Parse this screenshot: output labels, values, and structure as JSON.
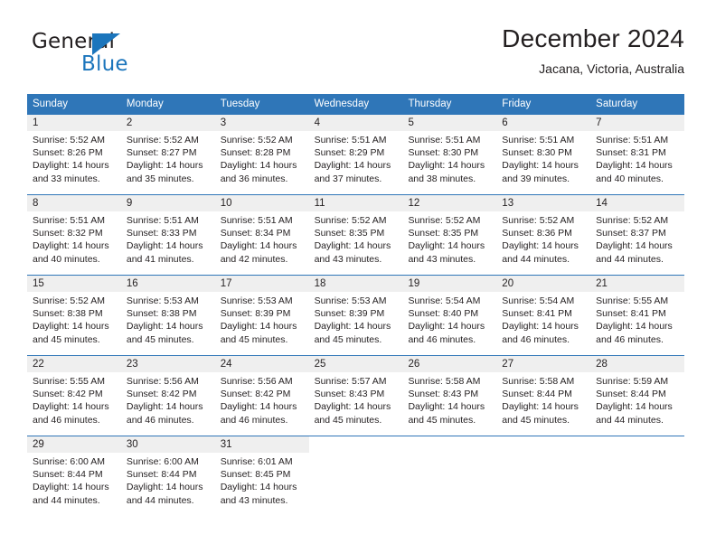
{
  "brand": {
    "name_top": "General",
    "name_bottom": "Blue",
    "accent_color": "#1b75bc",
    "triangle_icon": "logo-triangle"
  },
  "header": {
    "title": "December 2024",
    "subtitle": "Jacana, Victoria, Australia"
  },
  "calendar": {
    "header_bg": "#2f76b8",
    "header_text_color": "#ffffff",
    "daynum_bg": "#efefef",
    "weekdays": [
      "Sunday",
      "Monday",
      "Tuesday",
      "Wednesday",
      "Thursday",
      "Friday",
      "Saturday"
    ],
    "weeks": [
      [
        {
          "day": "1",
          "sunrise": "Sunrise: 5:52 AM",
          "sunset": "Sunset: 8:26 PM",
          "daylight": "Daylight: 14 hours and 33 minutes."
        },
        {
          "day": "2",
          "sunrise": "Sunrise: 5:52 AM",
          "sunset": "Sunset: 8:27 PM",
          "daylight": "Daylight: 14 hours and 35 minutes."
        },
        {
          "day": "3",
          "sunrise": "Sunrise: 5:52 AM",
          "sunset": "Sunset: 8:28 PM",
          "daylight": "Daylight: 14 hours and 36 minutes."
        },
        {
          "day": "4",
          "sunrise": "Sunrise: 5:51 AM",
          "sunset": "Sunset: 8:29 PM",
          "daylight": "Daylight: 14 hours and 37 minutes."
        },
        {
          "day": "5",
          "sunrise": "Sunrise: 5:51 AM",
          "sunset": "Sunset: 8:30 PM",
          "daylight": "Daylight: 14 hours and 38 minutes."
        },
        {
          "day": "6",
          "sunrise": "Sunrise: 5:51 AM",
          "sunset": "Sunset: 8:30 PM",
          "daylight": "Daylight: 14 hours and 39 minutes."
        },
        {
          "day": "7",
          "sunrise": "Sunrise: 5:51 AM",
          "sunset": "Sunset: 8:31 PM",
          "daylight": "Daylight: 14 hours and 40 minutes."
        }
      ],
      [
        {
          "day": "8",
          "sunrise": "Sunrise: 5:51 AM",
          "sunset": "Sunset: 8:32 PM",
          "daylight": "Daylight: 14 hours and 40 minutes."
        },
        {
          "day": "9",
          "sunrise": "Sunrise: 5:51 AM",
          "sunset": "Sunset: 8:33 PM",
          "daylight": "Daylight: 14 hours and 41 minutes."
        },
        {
          "day": "10",
          "sunrise": "Sunrise: 5:51 AM",
          "sunset": "Sunset: 8:34 PM",
          "daylight": "Daylight: 14 hours and 42 minutes."
        },
        {
          "day": "11",
          "sunrise": "Sunrise: 5:52 AM",
          "sunset": "Sunset: 8:35 PM",
          "daylight": "Daylight: 14 hours and 43 minutes."
        },
        {
          "day": "12",
          "sunrise": "Sunrise: 5:52 AM",
          "sunset": "Sunset: 8:35 PM",
          "daylight": "Daylight: 14 hours and 43 minutes."
        },
        {
          "day": "13",
          "sunrise": "Sunrise: 5:52 AM",
          "sunset": "Sunset: 8:36 PM",
          "daylight": "Daylight: 14 hours and 44 minutes."
        },
        {
          "day": "14",
          "sunrise": "Sunrise: 5:52 AM",
          "sunset": "Sunset: 8:37 PM",
          "daylight": "Daylight: 14 hours and 44 minutes."
        }
      ],
      [
        {
          "day": "15",
          "sunrise": "Sunrise: 5:52 AM",
          "sunset": "Sunset: 8:38 PM",
          "daylight": "Daylight: 14 hours and 45 minutes."
        },
        {
          "day": "16",
          "sunrise": "Sunrise: 5:53 AM",
          "sunset": "Sunset: 8:38 PM",
          "daylight": "Daylight: 14 hours and 45 minutes."
        },
        {
          "day": "17",
          "sunrise": "Sunrise: 5:53 AM",
          "sunset": "Sunset: 8:39 PM",
          "daylight": "Daylight: 14 hours and 45 minutes."
        },
        {
          "day": "18",
          "sunrise": "Sunrise: 5:53 AM",
          "sunset": "Sunset: 8:39 PM",
          "daylight": "Daylight: 14 hours and 45 minutes."
        },
        {
          "day": "19",
          "sunrise": "Sunrise: 5:54 AM",
          "sunset": "Sunset: 8:40 PM",
          "daylight": "Daylight: 14 hours and 46 minutes."
        },
        {
          "day": "20",
          "sunrise": "Sunrise: 5:54 AM",
          "sunset": "Sunset: 8:41 PM",
          "daylight": "Daylight: 14 hours and 46 minutes."
        },
        {
          "day": "21",
          "sunrise": "Sunrise: 5:55 AM",
          "sunset": "Sunset: 8:41 PM",
          "daylight": "Daylight: 14 hours and 46 minutes."
        }
      ],
      [
        {
          "day": "22",
          "sunrise": "Sunrise: 5:55 AM",
          "sunset": "Sunset: 8:42 PM",
          "daylight": "Daylight: 14 hours and 46 minutes."
        },
        {
          "day": "23",
          "sunrise": "Sunrise: 5:56 AM",
          "sunset": "Sunset: 8:42 PM",
          "daylight": "Daylight: 14 hours and 46 minutes."
        },
        {
          "day": "24",
          "sunrise": "Sunrise: 5:56 AM",
          "sunset": "Sunset: 8:42 PM",
          "daylight": "Daylight: 14 hours and 46 minutes."
        },
        {
          "day": "25",
          "sunrise": "Sunrise: 5:57 AM",
          "sunset": "Sunset: 8:43 PM",
          "daylight": "Daylight: 14 hours and 45 minutes."
        },
        {
          "day": "26",
          "sunrise": "Sunrise: 5:58 AM",
          "sunset": "Sunset: 8:43 PM",
          "daylight": "Daylight: 14 hours and 45 minutes."
        },
        {
          "day": "27",
          "sunrise": "Sunrise: 5:58 AM",
          "sunset": "Sunset: 8:44 PM",
          "daylight": "Daylight: 14 hours and 45 minutes."
        },
        {
          "day": "28",
          "sunrise": "Sunrise: 5:59 AM",
          "sunset": "Sunset: 8:44 PM",
          "daylight": "Daylight: 14 hours and 44 minutes."
        }
      ],
      [
        {
          "day": "29",
          "sunrise": "Sunrise: 6:00 AM",
          "sunset": "Sunset: 8:44 PM",
          "daylight": "Daylight: 14 hours and 44 minutes."
        },
        {
          "day": "30",
          "sunrise": "Sunrise: 6:00 AM",
          "sunset": "Sunset: 8:44 PM",
          "daylight": "Daylight: 14 hours and 44 minutes."
        },
        {
          "day": "31",
          "sunrise": "Sunrise: 6:01 AM",
          "sunset": "Sunset: 8:45 PM",
          "daylight": "Daylight: 14 hours and 43 minutes."
        },
        {
          "day": "",
          "sunrise": "",
          "sunset": "",
          "daylight": ""
        },
        {
          "day": "",
          "sunrise": "",
          "sunset": "",
          "daylight": ""
        },
        {
          "day": "",
          "sunrise": "",
          "sunset": "",
          "daylight": ""
        },
        {
          "day": "",
          "sunrise": "",
          "sunset": "",
          "daylight": ""
        }
      ]
    ]
  }
}
